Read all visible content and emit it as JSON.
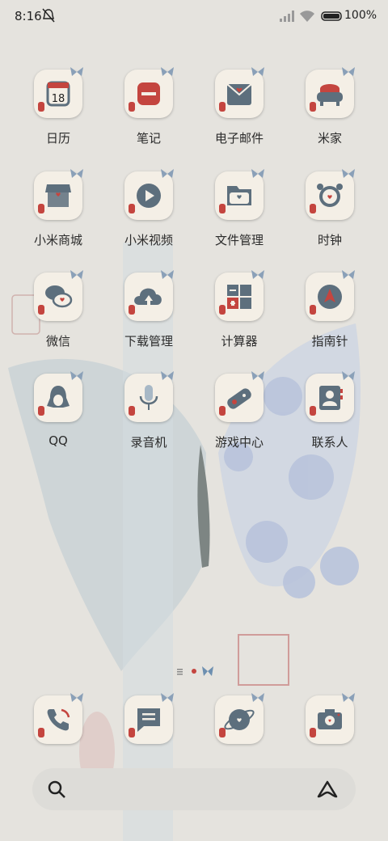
{
  "status": {
    "time": "8:16",
    "battery_pct": "100%"
  },
  "apps": [
    {
      "label": "日历",
      "calendar_day": "18"
    },
    {
      "label": "笔记"
    },
    {
      "label": "电子邮件"
    },
    {
      "label": "米家"
    },
    {
      "label": "小米商城"
    },
    {
      "label": "小米视频"
    },
    {
      "label": "文件管理"
    },
    {
      "label": "时钟"
    },
    {
      "label": "微信"
    },
    {
      "label": "下载管理"
    },
    {
      "label": "计算器"
    },
    {
      "label": "指南针"
    },
    {
      "label": "QQ"
    },
    {
      "label": "录音机"
    },
    {
      "label": "游戏中心"
    },
    {
      "label": "联系人"
    }
  ],
  "dock": [
    {
      "icon": "phone-icon"
    },
    {
      "icon": "messages-icon"
    },
    {
      "icon": "browser-icon"
    },
    {
      "icon": "camera-icon"
    }
  ],
  "colors": {
    "icon_primary": "#5d6f7d",
    "accent_red": "#c4453f",
    "tile_bg": "#f4efe6"
  }
}
